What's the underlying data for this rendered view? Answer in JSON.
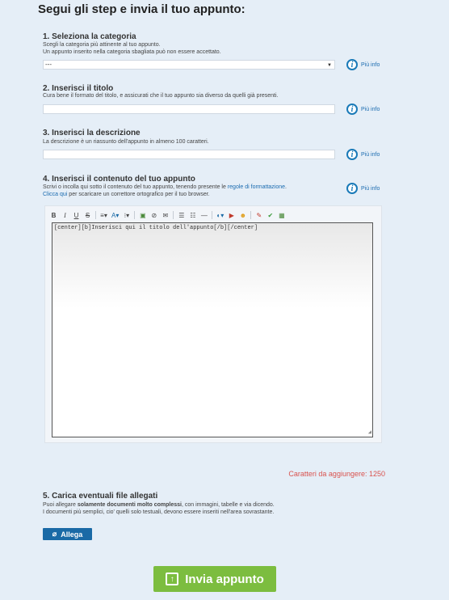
{
  "page_title": "Segui gli step e invia il tuo appunto:",
  "more_info_label": "Più info",
  "step1": {
    "heading": "1. Seleziona la categoria",
    "line1": "Scegli la categoria più attinente al tuo appunto.",
    "line2": "Un appunto inserito nella categoria sbagliata può non essere accettato.",
    "select_value": "---"
  },
  "step2": {
    "heading": "2. Inserisci il titolo",
    "line1": "Cura bene il formato del titolo, e assicurati che il tuo appunto sia diverso da quelli già presenti.",
    "value": ""
  },
  "step3": {
    "heading": "3. Inserisci la descrizione",
    "line1": "La descrizione è un riassunto dell'appunto in almeno 100 caratteri.",
    "value": ""
  },
  "step4": {
    "heading": "4. Inserisci il contenuto del tuo appunto",
    "line1_pre": "Scrivi o incolla qui sotto il contenuto del tuo appunto, tenendo presente le ",
    "line1_link": "regole di formattazione",
    "line1_post": ".",
    "line2_link": "Clicca qui",
    "line2_post": " per scaricare un correttore ortografico per il tuo browser.",
    "editor_text": "[center][b]Inserisci qui il titolo dell'appunto[/b][/center]"
  },
  "toolbar": {
    "bold": "B",
    "italic": "I",
    "underline": "U",
    "strike": "S",
    "align": "≡▾",
    "font": "A▾",
    "size": "⁝▾",
    "image": "▣",
    "link": "⊘",
    "email": "✉",
    "ul": "☰",
    "ol": "☷",
    "hr": "—",
    "color": "◐▾",
    "youtube": "▶",
    "emoticon": "☻",
    "spell": "✎",
    "check": "✔",
    "table": "▦"
  },
  "counter_label": "Caratteri da aggiungere: 1250",
  "step5": {
    "heading": "5. Carica eventuali file allegati",
    "line1_pre": "Puoi allegare ",
    "line1_bold": "solamente documenti molto complessi",
    "line1_post": ", con immagini, tabelle e via dicendo.",
    "line2": "I documenti più semplici, cio'  quelli solo testuali, devono essere inseriti nell'area sovrastante."
  },
  "attach_label": "Allega",
  "submit_label": "Invia appunto",
  "colors": {
    "accent": "#1a6aa6",
    "submit": "#7cbd3f",
    "counter": "#d9534f",
    "background": "#e5eef7"
  }
}
